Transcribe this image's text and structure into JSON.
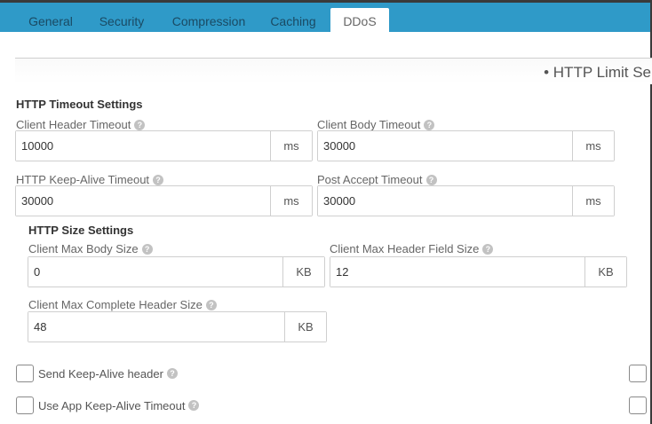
{
  "tabs": [
    {
      "label": "General"
    },
    {
      "label": "Security"
    },
    {
      "label": "Compression"
    },
    {
      "label": "Caching"
    },
    {
      "label": "DDoS",
      "active": true
    }
  ],
  "section": {
    "title": "• HTTP Limit Se"
  },
  "help_glyph": "?",
  "timeout": {
    "title": "HTTP Timeout Settings",
    "client_header": {
      "label": "Client Header Timeout",
      "value": "10000",
      "unit": "ms"
    },
    "client_body": {
      "label": "Client Body Timeout",
      "value": "30000",
      "unit": "ms"
    },
    "keep_alive": {
      "label": "HTTP Keep-Alive Timeout",
      "value": "30000",
      "unit": "ms"
    },
    "post_accept": {
      "label": "Post Accept Timeout",
      "value": "30000",
      "unit": "ms"
    }
  },
  "size": {
    "title": "HTTP Size Settings",
    "max_body": {
      "label": "Client Max Body Size",
      "value": "0",
      "unit": "KB"
    },
    "max_header_field": {
      "label": "Client Max Header Field Size",
      "value": "12",
      "unit": "KB"
    },
    "max_complete_header": {
      "label": "Client Max Complete Header Size",
      "value": "48",
      "unit": "KB"
    }
  },
  "checkboxes": {
    "send_keep_alive": {
      "label": "Send Keep-Alive header",
      "checked": false
    },
    "use_app_keep_alive": {
      "label": "Use App Keep-Alive Timeout",
      "checked": false
    }
  },
  "colors": {
    "tabbar": "#2f9ac8",
    "frame": "#3a3a3a"
  }
}
